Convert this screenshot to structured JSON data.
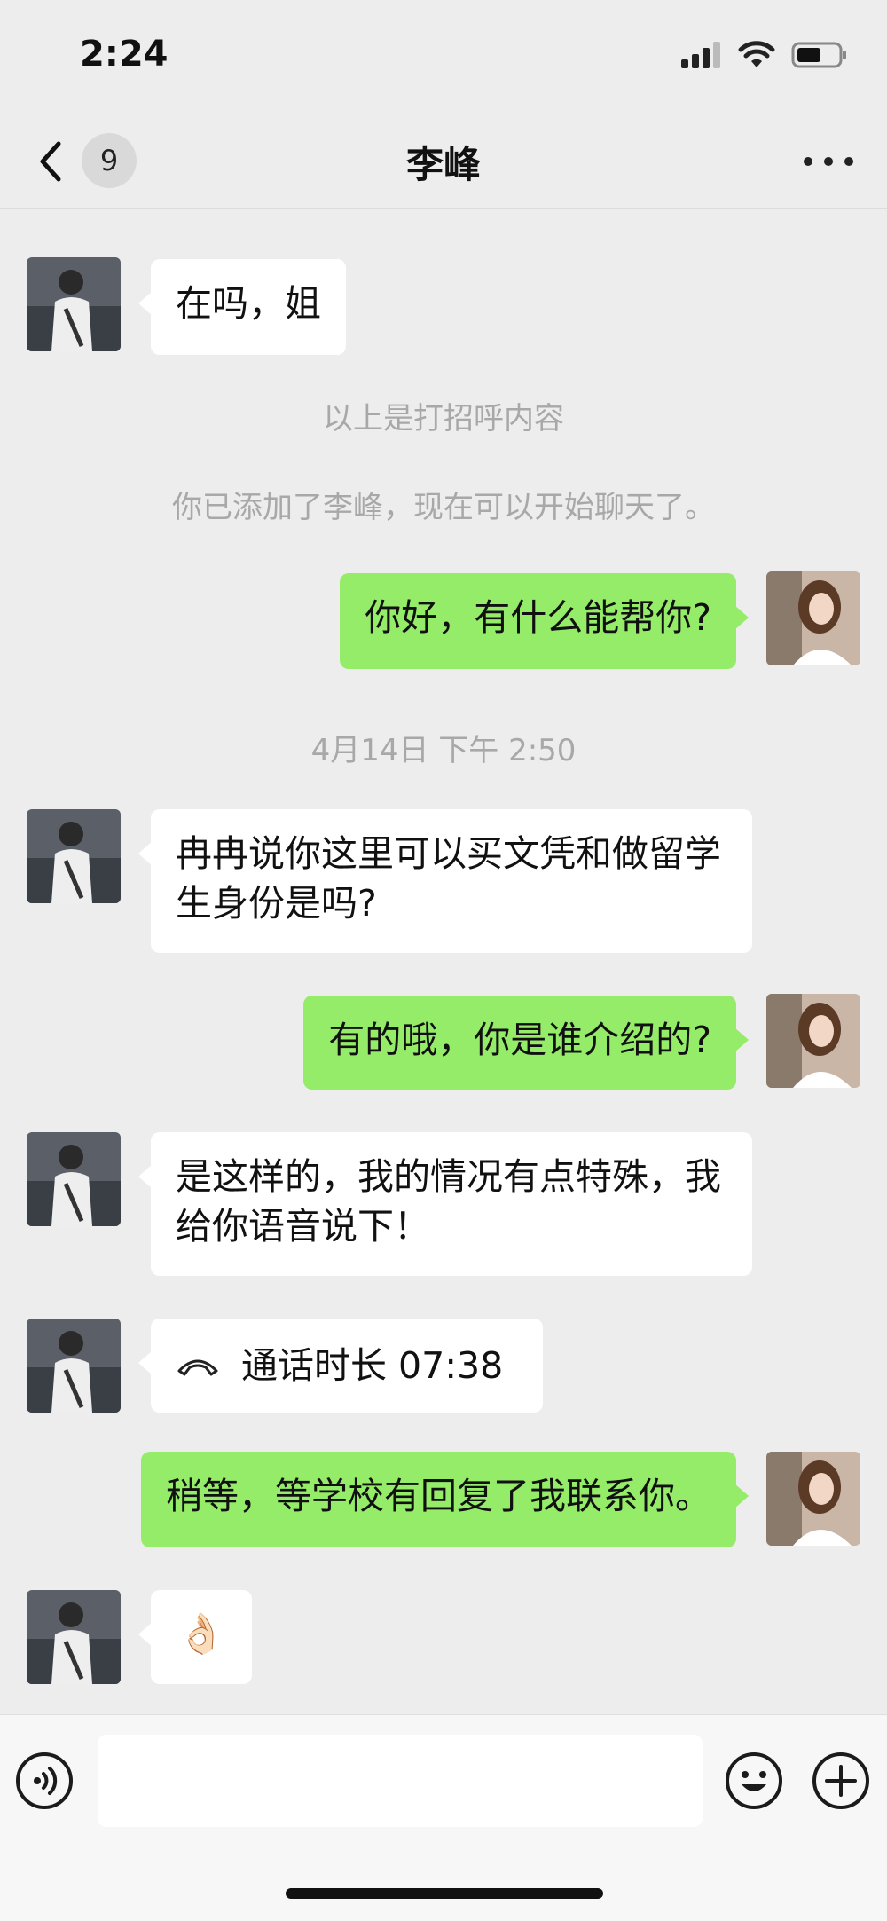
{
  "status_bar": {
    "time": "2:24"
  },
  "header": {
    "back_count": "9",
    "title": "李峰"
  },
  "messages": [
    {
      "side": "left",
      "text": "在吗，姐"
    },
    {
      "side": "system",
      "text": "以上是打招呼内容"
    },
    {
      "side": "system",
      "text": "你已添加了李峰，现在可以开始聊天了。"
    },
    {
      "side": "right",
      "text": "你好，有什么能帮你?"
    },
    {
      "side": "system",
      "text": "4月14日 下午 2:50"
    },
    {
      "side": "left",
      "text": "冉冉说你这里可以买文凭和做留学生身份是吗?"
    },
    {
      "side": "right",
      "text": "有的哦，你是谁介绍的?"
    },
    {
      "side": "left",
      "text": "是这样的，我的情况有点特殊，我给你语音说下！"
    },
    {
      "side": "left",
      "type": "call",
      "text": "通话时长 07:38"
    },
    {
      "side": "right",
      "text": "稍等，等学校有回复了我联系你。"
    },
    {
      "side": "left",
      "type": "emoji",
      "text": "👌🏻"
    }
  ],
  "colors": {
    "background": "#ededed",
    "green_bubble": "#95ec69",
    "white_bubble": "#ffffff",
    "system_text": "#a8a8a8"
  },
  "icons": [
    "signal-icon",
    "wifi-icon",
    "battery-icon",
    "back-chevron-icon",
    "more-icon",
    "voice-icon",
    "emoji-icon",
    "plus-icon",
    "phone-icon"
  ]
}
